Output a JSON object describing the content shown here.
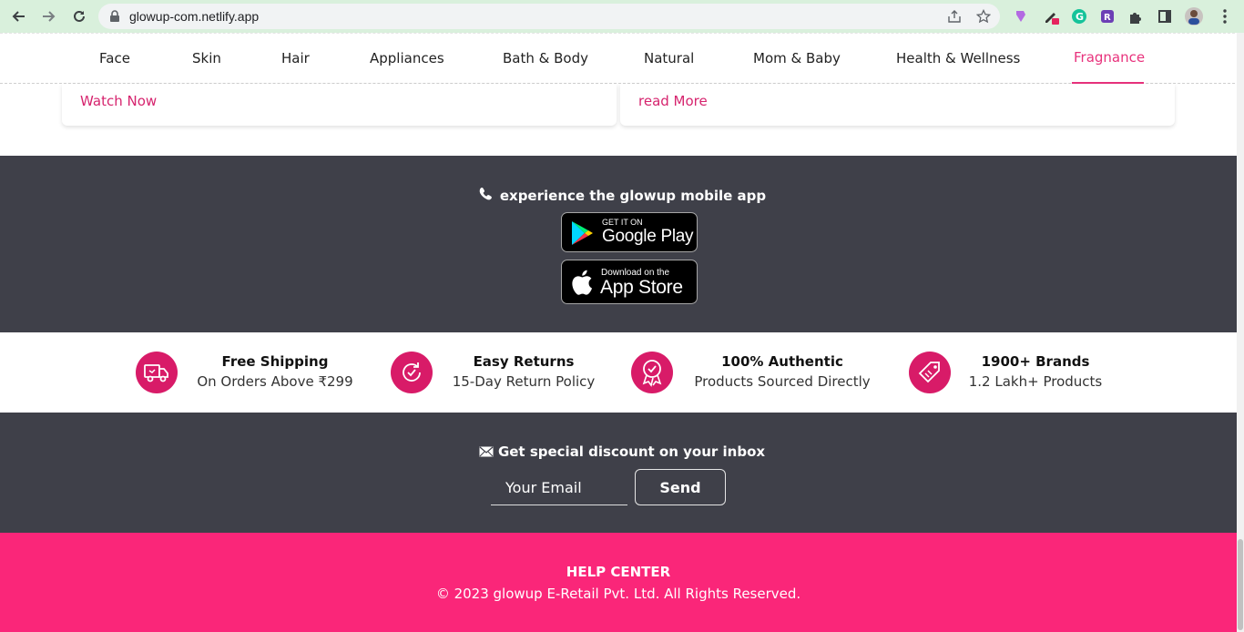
{
  "browser": {
    "url": "glowup-com.netlify.app"
  },
  "nav": {
    "items": [
      {
        "label": "Face"
      },
      {
        "label": "Skin"
      },
      {
        "label": "Hair"
      },
      {
        "label": "Appliances"
      },
      {
        "label": "Bath & Body"
      },
      {
        "label": "Natural"
      },
      {
        "label": "Mom & Baby"
      },
      {
        "label": "Health & Wellness"
      },
      {
        "label": "Fragnance"
      }
    ],
    "active": "Fragnance",
    "accent_color": "#e8327c"
  },
  "cards": [
    {
      "link": "Watch Now"
    },
    {
      "link": "read More"
    }
  ],
  "app": {
    "title": "experience the glowup mobile app",
    "google_small": "GET IT ON",
    "google_big": "Google Play",
    "apple_small": "Download on the",
    "apple_big": "App Store"
  },
  "features": [
    {
      "icon": "delivery-truck-icon",
      "title": "Free Shipping",
      "subtitle": "On Orders Above ₹299"
    },
    {
      "icon": "return-arrow-icon",
      "title": "Easy Returns",
      "subtitle": "15-Day Return Policy"
    },
    {
      "icon": "authentic-badge-icon",
      "title": "100% Authentic",
      "subtitle": "Products Sourced Directly"
    },
    {
      "icon": "price-tag-icon",
      "title": "1900+ Brands",
      "subtitle": "1.2 Lakh+ Products"
    }
  ],
  "newsletter": {
    "title": "Get special discount on your inbox",
    "placeholder": "Your Email",
    "button": "Send"
  },
  "footer": {
    "help": "HELP CENTER",
    "copyright": "© 2023 glowup E-Retail Pvt. Ltd. All Rights Reserved."
  },
  "colors": {
    "dark_bg": "#3f4049",
    "footer_bg": "#fa2679",
    "feature_icon_bg": "#d81b68"
  }
}
